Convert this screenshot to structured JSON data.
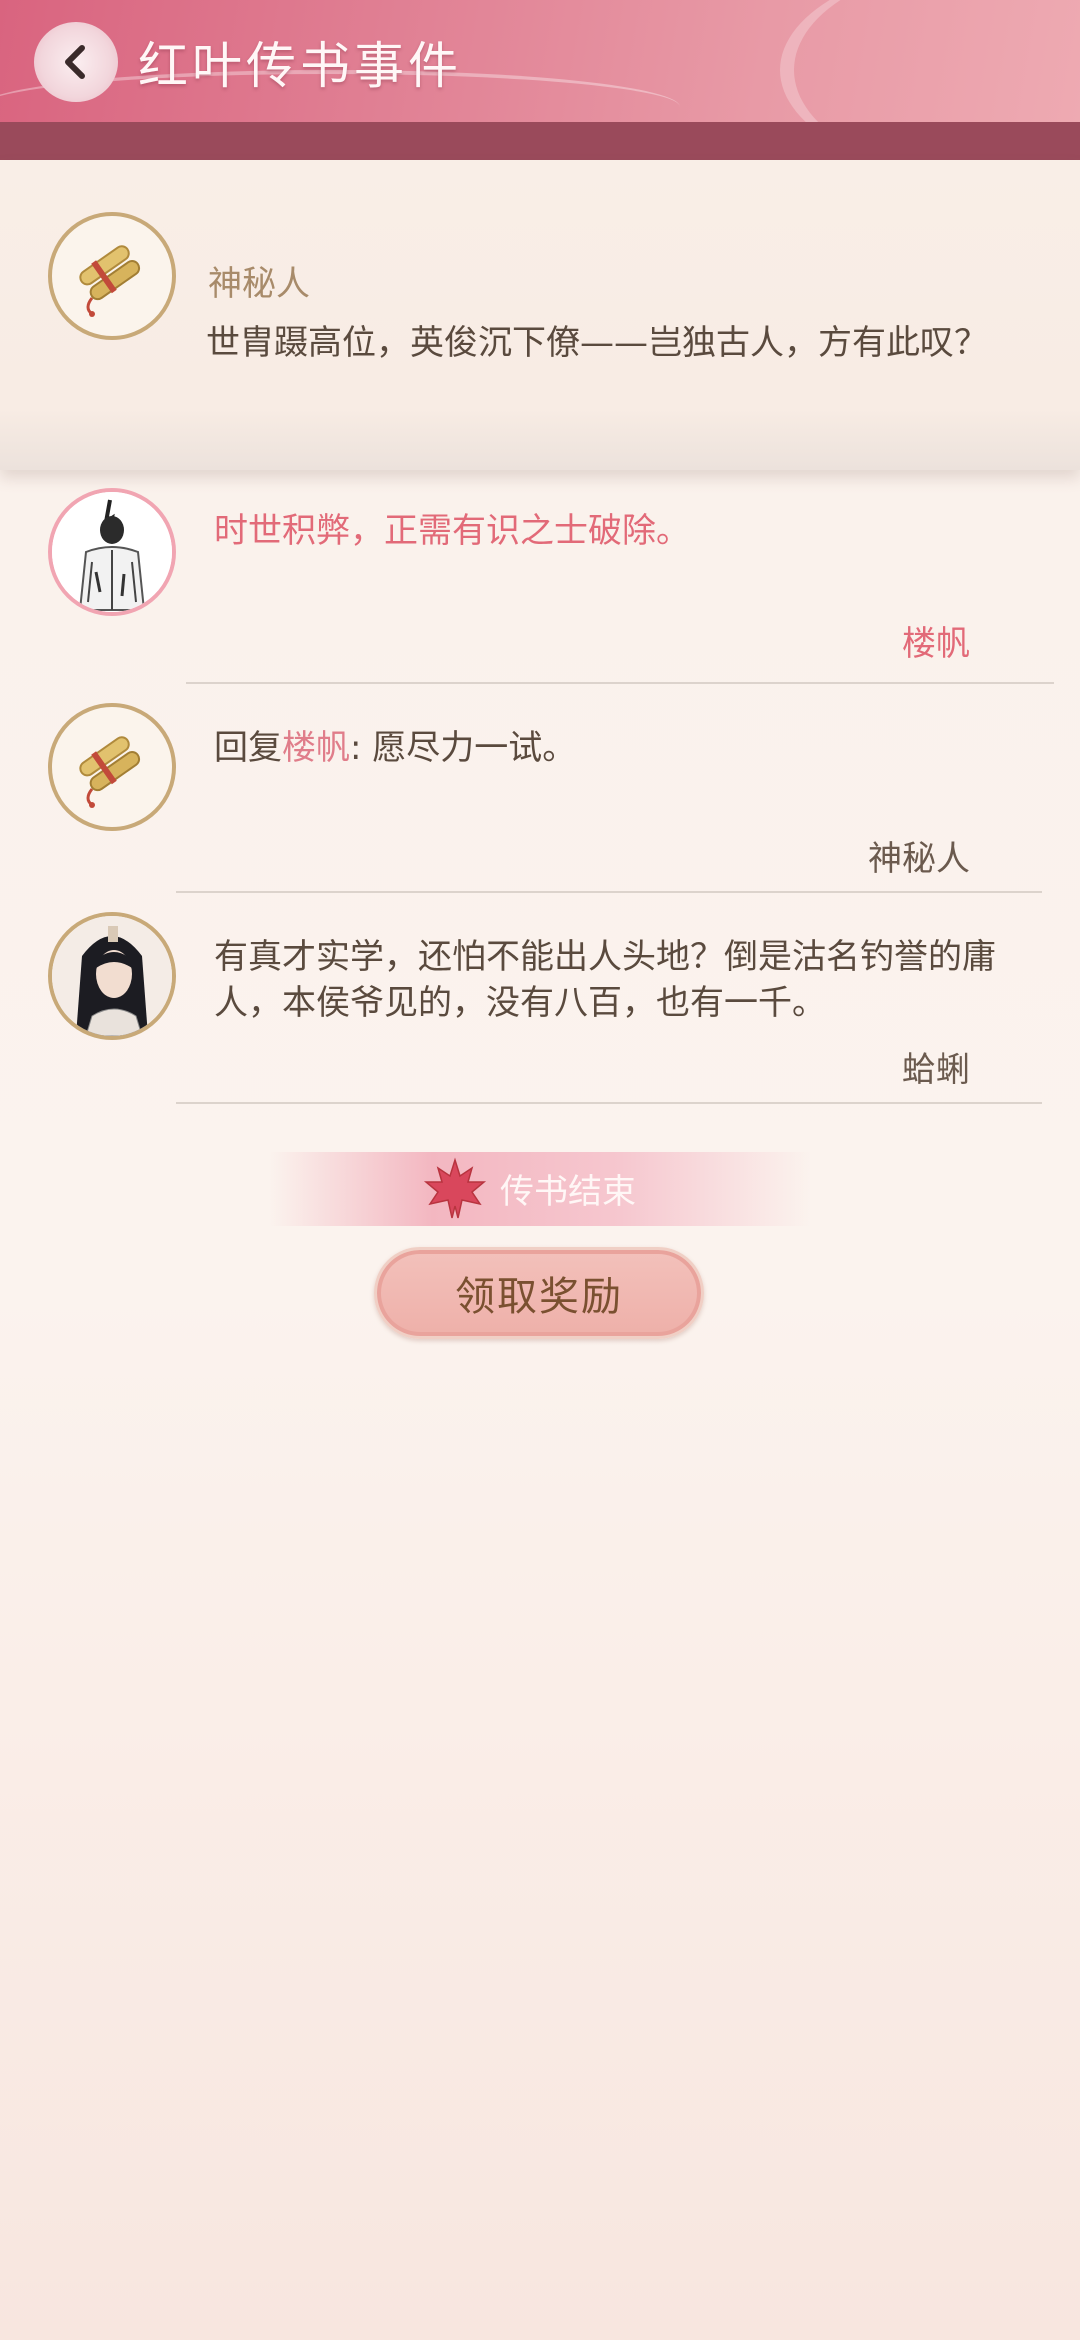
{
  "header": {
    "title": "红叶传书事件"
  },
  "top_message": {
    "author": "神秘人",
    "text": "世胄蹑高位，英俊沉下僚——岂独古人，方有此叹？",
    "avatar_icon": "scroll-icon"
  },
  "replies": [
    {
      "text": "时世积弊，正需有识之士破除。",
      "author": "楼帆",
      "avatar_icon": "ink-portrait-avatar"
    },
    {
      "prefix": "回复",
      "reply_to": "楼帆",
      "text": ": 愿尽力一试。",
      "author": "神秘人",
      "avatar_icon": "scroll-icon"
    },
    {
      "text": "有真才实学，还怕不能出人头地？倒是沽名钓誉的庸人，本侯爷见的，没有八百，也有一千。",
      "author": "蛤蜊",
      "avatar_icon": "character-portrait-avatar"
    }
  ],
  "end_banner": {
    "text": "传书结束",
    "icon": "maple-leaf-icon"
  },
  "reward_button": {
    "label": "领取奖励"
  },
  "colors": {
    "accent": "#e26a78",
    "header": "#d9647f",
    "band": "#9a4a5b"
  }
}
